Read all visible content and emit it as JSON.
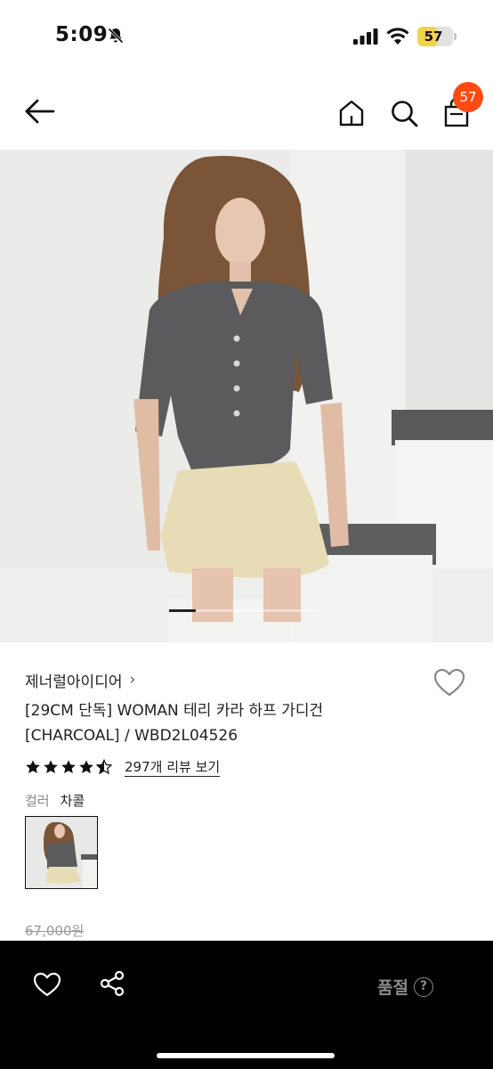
{
  "status_bar": {
    "time": "5:09",
    "battery_level": "57",
    "battery_percent": 57,
    "icons": [
      "bell-slash-icon",
      "cellular-signal-icon",
      "wifi-icon",
      "battery-icon"
    ]
  },
  "nav": {
    "icons": [
      "back-arrow-icon",
      "home-icon",
      "search-icon",
      "shopping-bag-icon"
    ],
    "cart_count": "57"
  },
  "carousel": {
    "active_index": 1
  },
  "product": {
    "brand": "제너럴아이디어",
    "brand_chevron": "›",
    "title_line1": "[29CM 단독] WOMAN 테리 카라 하프 가디건",
    "title_line2": "[CHARCOAL] / WBD2L04526",
    "rating_stars": 4.5,
    "review_link": "297개 리뷰 보기",
    "color_label": "컬러",
    "color_value": "차콜",
    "price_original": "67,000원"
  },
  "bottom_bar": {
    "icons": [
      "heart-icon",
      "share-icon",
      "help-circle-icon"
    ],
    "status": "품절",
    "help_glyph": "?"
  },
  "colors": {
    "accent_badge": "#ff4b12",
    "battery_fill": "#f2d34a",
    "bottom_bar_bg": "#000000",
    "soldout_text": "#8a8a8a"
  }
}
